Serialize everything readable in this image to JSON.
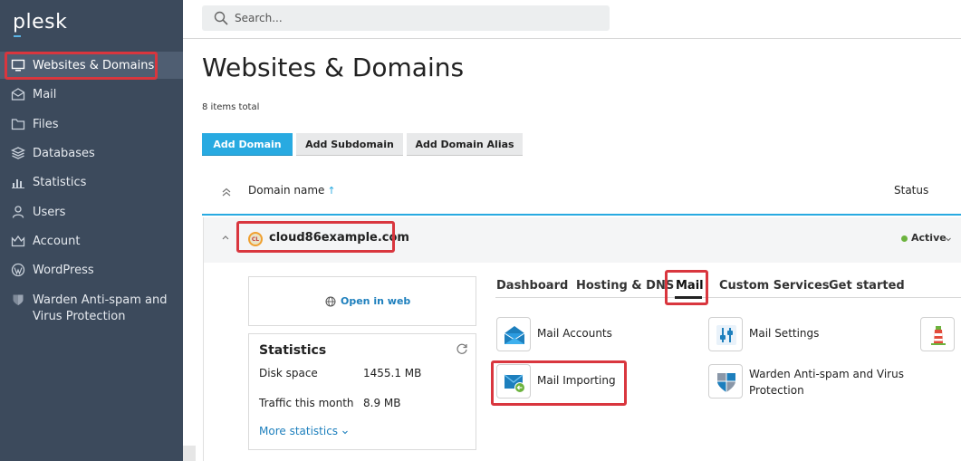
{
  "app": {
    "logo_text": "plesk"
  },
  "sidebar": {
    "items": [
      {
        "label": "Websites & Domains",
        "icon": "monitor-icon"
      },
      {
        "label": "Mail",
        "icon": "envelope-icon"
      },
      {
        "label": "Files",
        "icon": "folder-icon"
      },
      {
        "label": "Databases",
        "icon": "database-icon"
      },
      {
        "label": "Statistics",
        "icon": "bar-chart-icon"
      },
      {
        "label": "Users",
        "icon": "user-icon"
      },
      {
        "label": "Account",
        "icon": "account-icon"
      },
      {
        "label": "WordPress",
        "icon": "wordpress-icon"
      },
      {
        "label": "Warden Anti-spam and Virus Protection",
        "icon": "shield-icon"
      }
    ]
  },
  "search": {
    "placeholder": "Search..."
  },
  "page": {
    "title": "Websites & Domains",
    "items_total": "8 items total"
  },
  "toolbar": {
    "add_domain": "Add Domain",
    "add_subdomain": "Add Subdomain",
    "add_domain_alias": "Add Domain Alias"
  },
  "table": {
    "col_domain": "Domain name",
    "sort_arrow": "↑",
    "col_status": "Status"
  },
  "domain": {
    "badge": "CL",
    "name": "cloud86example.com",
    "status": "Active",
    "status_color": "#6cb33e"
  },
  "open_in_web": "Open in web",
  "statistics": {
    "title": "Statistics",
    "rows": [
      {
        "label": "Disk space",
        "value": "1455.1 MB"
      },
      {
        "label": "Traffic this month",
        "value": "8.9 MB"
      }
    ],
    "more": "More statistics"
  },
  "tabs": [
    {
      "label": "Dashboard"
    },
    {
      "label": "Hosting & DNS"
    },
    {
      "label": "Mail",
      "active": true
    },
    {
      "label": "Custom Services"
    },
    {
      "label": "Get started"
    }
  ],
  "tools": {
    "mail_accounts": "Mail Accounts",
    "mail_settings": "Mail Settings",
    "mail_importing": "Mail Importing",
    "warden": "Warden Anti-spam and Virus Protection"
  },
  "colors": {
    "sidebar_bg": "#3c4a5c",
    "accent": "#28aae1",
    "highlight": "#d9363e",
    "link": "#1d7fbd"
  }
}
